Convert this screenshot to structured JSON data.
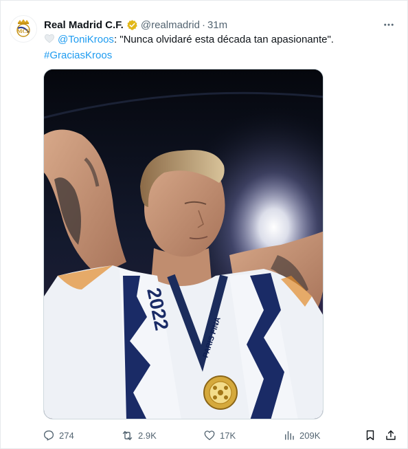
{
  "tweet": {
    "display_name": "Real Madrid C.F.",
    "handle": "@realmadrid",
    "separator": "·",
    "time": "31m",
    "more_icon": "more-horizontal-icon",
    "verified_icon": "verified-gold-badge-icon",
    "text": {
      "emoji": "white-heart-emoji",
      "mention": "@ToniKroos",
      "quote": ": \"Nunca olvidaré esta década tan apasionante\".",
      "hashtag": "#GraciasKroos"
    },
    "media": {
      "kind": "photo",
      "scarf_text": "2022",
      "shirt_text": "PARIS FINA"
    },
    "actions": {
      "replies": "274",
      "reposts": "2.9K",
      "likes": "17K",
      "views": "209K"
    }
  },
  "colors": {
    "link": "#1d9bf0",
    "secondary_text": "#536471",
    "verified_gold": "#e2b719"
  }
}
